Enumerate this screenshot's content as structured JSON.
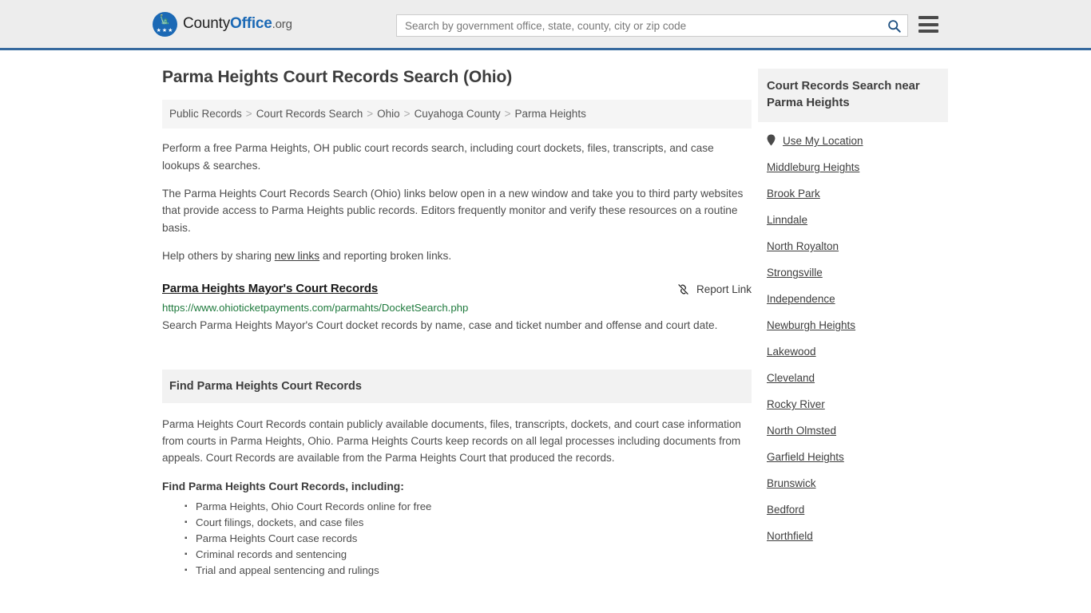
{
  "header": {
    "brand": {
      "county": "County",
      "office": "Office",
      "tld": ".org",
      "seal_icon": "eagle-seal-icon"
    },
    "search": {
      "placeholder": "Search by government office, state, county, city or zip code",
      "value": "",
      "search_icon": "search-icon"
    },
    "menu_icon": "hamburger-menu-icon",
    "accent_color": "#36699e",
    "background_color": "#ededed"
  },
  "main": {
    "title": "Parma Heights Court Records Search (Ohio)",
    "breadcrumb": [
      "Public Records",
      "Court Records Search",
      "Ohio",
      "Cuyahoga County",
      "Parma Heights"
    ],
    "breadcrumb_separator": ">",
    "intro_paragraph": "Perform a free Parma Heights, OH public court records search, including court dockets, files, transcripts, and case lookups & searches.",
    "description_paragraph": "The Parma Heights Court Records Search (Ohio) links below open in a new window and take you to third party websites that provide access to Parma Heights public records. Editors frequently monitor and verify these resources on a routine basis.",
    "help_prefix": "Help others by sharing ",
    "help_link": "new links",
    "help_suffix": " and reporting broken links.",
    "record": {
      "title": "Parma Heights Mayor's Court Records",
      "url": "https://www.ohioticketpayments.com/parmahts/DocketSearch.php",
      "url_color": "#1f7a3d",
      "description": "Search Parma Heights Mayor's Court docket records by name, case and ticket number and offense and court date.",
      "report_label": "Report Link",
      "report_icon": "broken-link-icon"
    },
    "find_section": {
      "header": "Find Parma Heights Court Records",
      "body": "Parma Heights Court Records contain publicly available documents, files, transcripts, dockets, and court case information from courts in Parma Heights, Ohio. Parma Heights Courts keep records on all legal processes including documents from appeals. Court Records are available from the Parma Heights Court that produced the records.",
      "subhead": "Find Parma Heights Court Records, including:",
      "bullets": [
        "Parma Heights, Ohio Court Records online for free",
        "Court filings, dockets, and case files",
        "Parma Heights Court case records",
        "Criminal records and sentencing",
        "Trial and appeal sentencing and rulings"
      ]
    }
  },
  "sidebar": {
    "header": "Court Records Search near Parma Heights",
    "use_my_location": {
      "label": "Use My Location",
      "icon": "map-pin-icon"
    },
    "cities": [
      "Middleburg Heights",
      "Brook Park",
      "Linndale",
      "North Royalton",
      "Strongsville",
      "Independence",
      "Newburgh Heights",
      "Lakewood",
      "Cleveland",
      "Rocky River",
      "North Olmsted",
      "Garfield Heights",
      "Brunswick",
      "Bedford",
      "Northfield"
    ]
  }
}
